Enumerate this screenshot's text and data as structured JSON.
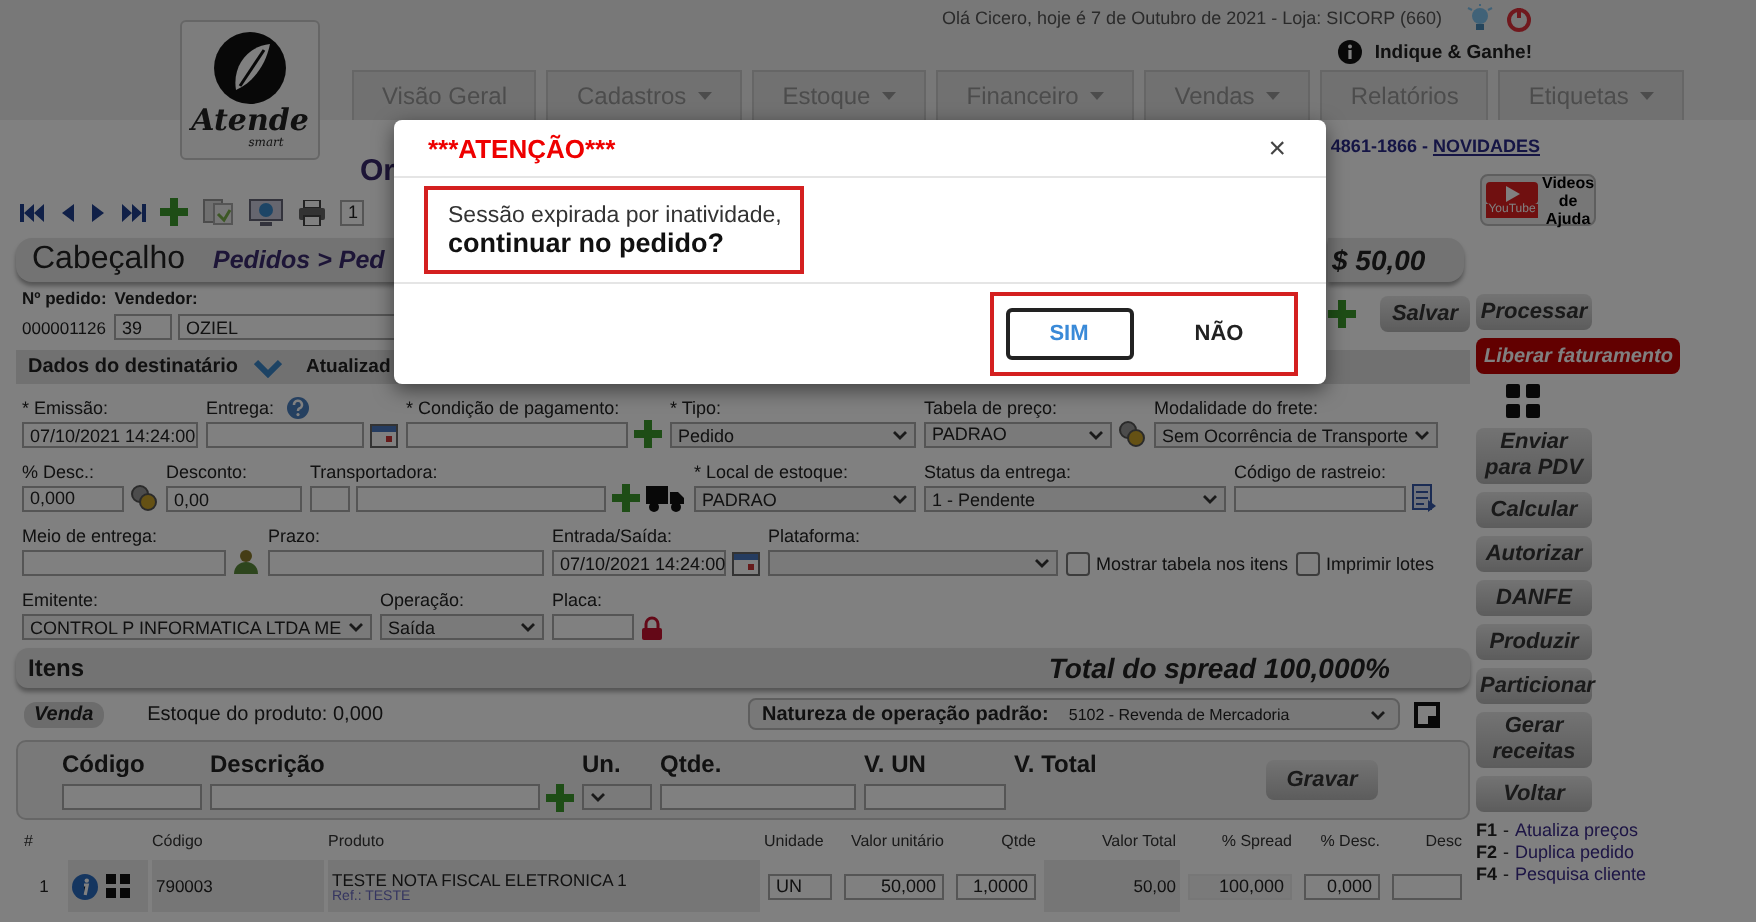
{
  "header": {
    "logo": {
      "name": "Atende",
      "tagline": "smart"
    },
    "greeting": "Olá Cicero, hoje é 7 de Outubro de 2021 - Loja: SICORP (660)",
    "referral": "Indique & Ganhe!"
  },
  "nav_tabs": [
    {
      "label": "Visão Geral",
      "dropdown": false
    },
    {
      "label": "Cadastros",
      "dropdown": true
    },
    {
      "label": "Estoque",
      "dropdown": true
    },
    {
      "label": "Financeiro",
      "dropdown": true
    },
    {
      "label": "Vendas",
      "dropdown": true
    },
    {
      "label": "Relatórios",
      "dropdown": false
    },
    {
      "label": "Etiquetas",
      "dropdown": true
    }
  ],
  "page_title": "Or",
  "contact": {
    "phone": "4861-1866 -",
    "link": "NOVIDADES"
  },
  "toolbar": {
    "page": "1"
  },
  "help_videos": {
    "badge": "YouTube",
    "label": "Videos de Ajuda"
  },
  "section": {
    "title": "Cabeçalho",
    "breadcrumb": "Pedidos > Ped",
    "total": "$ 50,00"
  },
  "order": {
    "number_label": "Nº pedido:",
    "seller_label": "Vendedor:",
    "number": "000001126",
    "seller_code": "39",
    "seller_name": "OZIEL",
    "save": "Salvar"
  },
  "recipient_bar": {
    "title": "Dados do destinatário",
    "extra": "Atualizad"
  },
  "form_rows": [
    [
      {
        "label": "* Emissão:",
        "kind": "text",
        "value": "07/10/2021 14:24:00"
      },
      {
        "label": "Entrega:",
        "label_icon": {
          "kind": "help"
        },
        "kind": "text",
        "icons": [
          {
            "kind": "calendar"
          }
        ]
      },
      {
        "label": "* Condição de pagamento:",
        "kind": "text",
        "icons": [
          {
            "kind": "plus"
          }
        ]
      },
      {
        "label": "* Tipo:",
        "kind": "select",
        "value": "Pedido"
      },
      {
        "label": "Tabela de preço:",
        "kind": "select",
        "value": "PADRAO",
        "icons": [
          {
            "kind": "gear"
          }
        ]
      },
      {
        "label": "Modalidade do frete:",
        "kind": "select",
        "value": "Sem Ocorrência de Transporte"
      }
    ],
    [
      {
        "label": "% Desc.:",
        "kind": "text",
        "value": "0,000",
        "icons": [
          {
            "kind": "gear"
          }
        ]
      },
      {
        "label": "Desconto:",
        "kind": "text",
        "value": "0,00"
      },
      {
        "label": "Transportadora:",
        "kind": "pair",
        "icons": [
          {
            "kind": "plus"
          },
          {
            "kind": "truck"
          }
        ]
      },
      {
        "label": "* Local de estoque:",
        "kind": "select",
        "value": "PADRAO"
      },
      {
        "label": "Status da entrega:",
        "kind": "select",
        "value": "1 - Pendente"
      },
      {
        "label": "Código de rastreio:",
        "kind": "text",
        "icons": [
          {
            "kind": "doc"
          }
        ]
      }
    ],
    [
      {
        "label": "Meio de entrega:",
        "kind": "text",
        "icons": [
          {
            "kind": "person"
          }
        ]
      },
      {
        "label": "Prazo:",
        "kind": "text"
      },
      {
        "label": "Entrada/Saída:",
        "kind": "text",
        "value": "07/10/2021 14:24:00",
        "icons": [
          {
            "kind": "calendar"
          }
        ]
      },
      {
        "label": "Plataforma:",
        "kind": "select"
      },
      {
        "label": "Mostrar tabela nos itens",
        "kind": "checkbox",
        "checked": false
      },
      {
        "label": "Imprimir lotes",
        "kind": "checkbox",
        "checked": false
      }
    ],
    [
      {
        "label": "Emitente:",
        "kind": "select",
        "value": "CONTROL P INFORMATICA LTDA ME"
      },
      {
        "label": "Operação:",
        "kind": "select",
        "value": "Saída"
      },
      {
        "label": "Placa:",
        "kind": "text",
        "icons": [
          {
            "kind": "lock"
          }
        ]
      }
    ]
  ],
  "items": {
    "title": "Itens",
    "spread": "Total do spread 100,000%",
    "mode": "Venda",
    "stock": "Estoque do produto: 0,000",
    "nature_label": "Natureza de operação padrão:",
    "nature_value": "5102 - Revenda de Mercadoria"
  },
  "entry": {
    "fields": [
      {
        "label": "Código",
        "kind": "text"
      },
      {
        "label": "Descrição",
        "kind": "text",
        "icons": [
          {
            "kind": "plus"
          }
        ]
      },
      {
        "label": "Un.",
        "kind": "select"
      },
      {
        "label": "Qtde.",
        "kind": "text"
      },
      {
        "label": "V. UN",
        "kind": "text"
      },
      {
        "label": "V. Total",
        "kind": "none"
      }
    ],
    "save": "Gravar"
  },
  "table": {
    "columns": [
      "#",
      "Código",
      "Produto",
      "Unidade",
      "Valor unitário",
      "Qtde",
      "Valor Total",
      "% Spread",
      "% Desc.",
      "Desc"
    ],
    "rows": [
      {
        "index": "1",
        "code": "790003",
        "product": "TESTE NOTA FISCAL ELETRONICA 1",
        "ref": "Ref.: TESTE",
        "unit": "UN",
        "unit_price": "50,000",
        "qty": "1,0000",
        "total": "50,00",
        "spread": "100,000",
        "discount_pct": "0,000"
      }
    ]
  },
  "primary_actions": [
    {
      "label": "Processar",
      "kind": "button"
    },
    {
      "label": "Liberar faturamento",
      "kind": "alert"
    }
  ],
  "actions": [
    {
      "label": "Enviar para PDV",
      "kind": "button"
    },
    {
      "label": "Calcular",
      "kind": "button"
    },
    {
      "label": "Autorizar",
      "kind": "button"
    },
    {
      "label": "DANFE",
      "kind": "button"
    },
    {
      "label": "Produzir",
      "kind": "button"
    },
    {
      "label": "Particionar",
      "kind": "button"
    },
    {
      "label": "Gerar receitas",
      "kind": "button"
    },
    {
      "label": "Voltar",
      "kind": "button"
    }
  ],
  "shortcuts": [
    {
      "key": "F1",
      "separator": "-",
      "label": "Atualiza preços"
    },
    {
      "key": "F2",
      "separator": "-",
      "label": "Duplica pedido"
    },
    {
      "key": "F4",
      "separator": "-",
      "label": "Pesquisa cliente"
    }
  ],
  "modal": {
    "title": "***ATENÇÃO***",
    "close": "×",
    "message": "Sessão expirada por inatividade,",
    "question": "continuar no pedido?",
    "buttons": [
      {
        "label": "SIM",
        "selected": true
      },
      {
        "label": "NÃO",
        "selected": false
      }
    ]
  }
}
